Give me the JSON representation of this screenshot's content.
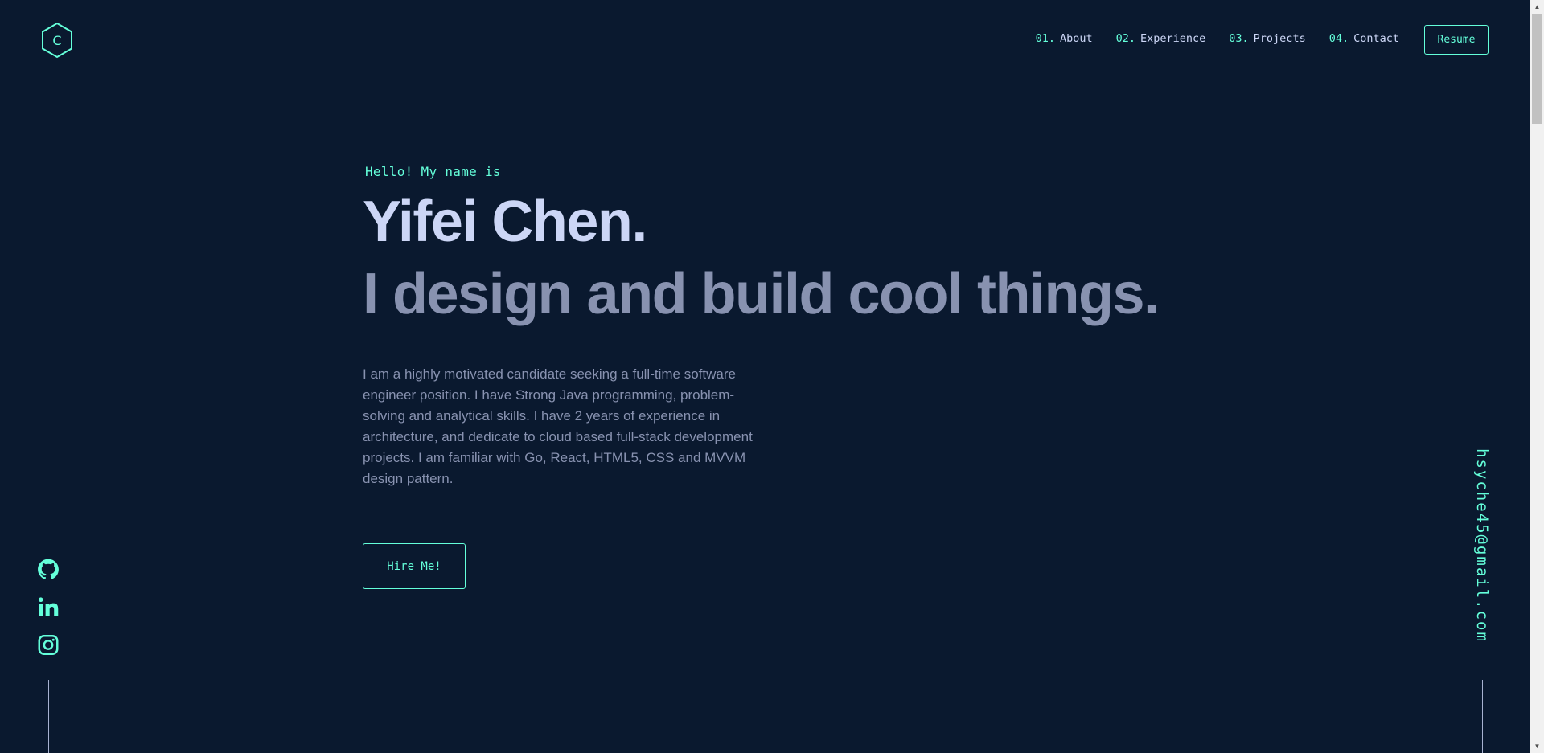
{
  "header": {
    "logo_letter": "C",
    "nav": [
      {
        "num": "01.",
        "label": "About"
      },
      {
        "num": "02.",
        "label": "Experience"
      },
      {
        "num": "03.",
        "label": "Projects"
      },
      {
        "num": "04.",
        "label": "Contact"
      }
    ],
    "resume_label": "Resume"
  },
  "hero": {
    "intro": "Hello! My name is",
    "name": "Yifei Chen.",
    "tagline": "I design and build cool things.",
    "description": "I am a highly motivated candidate seeking a full-time software engineer position. I have Strong Java programming, problem-solving and analytical skills. I have 2 years of experience in architecture, and dedicate to cloud based full-stack development projects. I am familiar with Go, React, HTML5, CSS and MVVM design pattern.",
    "cta_label": "Hire Me!"
  },
  "social": {
    "icons": [
      "github-icon",
      "linkedin-icon",
      "instagram-icon"
    ]
  },
  "email": "hsyche45@gmail.com",
  "colors": {
    "background": "#0a192f",
    "accent": "#64ffda",
    "heading": "#ccd6f6",
    "text": "#8892b0"
  }
}
